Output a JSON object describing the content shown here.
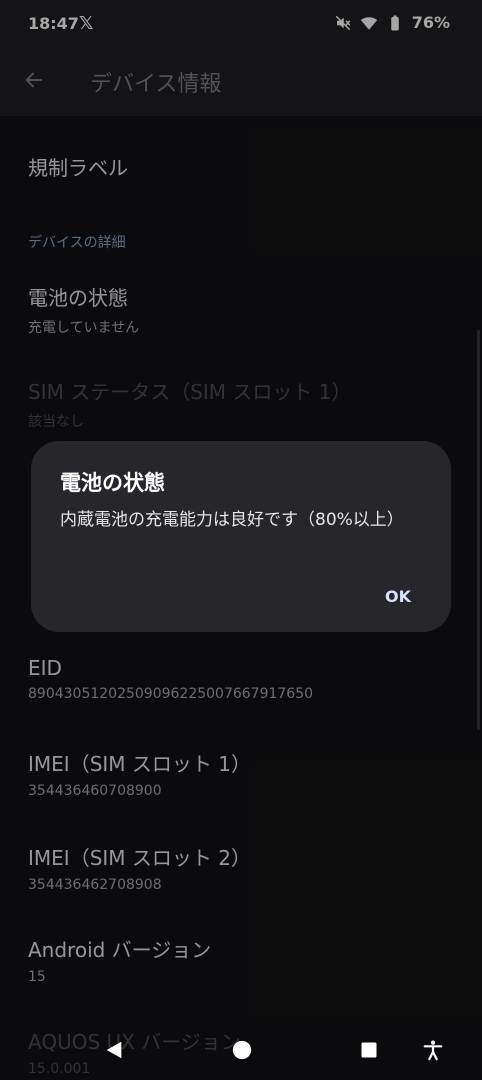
{
  "status_bar": {
    "time": "18:47",
    "battery_percent": "76%"
  },
  "app_bar": {
    "title": "デバイス情報"
  },
  "list": {
    "regulatory_label": "規制ラベル",
    "section_header": "デバイスの詳細",
    "items": [
      {
        "title": "電池の状態",
        "subtitle": "充電していません"
      },
      {
        "title": "SIM ステータス（SIM スロット 1）",
        "subtitle": "該当なし"
      },
      {
        "title": "EID",
        "subtitle": "89043051202509096225007667917650"
      },
      {
        "title": "IMEI（SIM スロット 1）",
        "subtitle": "354436460708900"
      },
      {
        "title": "IMEI（SIM スロット 2）",
        "subtitle": "354436462708908"
      },
      {
        "title": "Android バージョン",
        "subtitle": "15"
      },
      {
        "title": "AQUOS UX バージョン",
        "subtitle": "15.0.001"
      }
    ]
  },
  "dialog": {
    "title": "電池の状態",
    "message": "内蔵電池の充電能力は良好です（80%以上）",
    "ok_label": "OK"
  },
  "colors": {
    "background": "#121214",
    "dialog_background": "#26262b",
    "accent": "#d7e3ff",
    "section_header": "#8fa6c9"
  },
  "icons": {
    "status": [
      "x-logo-icon",
      "mute-icon",
      "wifi-icon",
      "battery-icon"
    ],
    "nav": [
      "back-triangle-icon",
      "home-circle-icon",
      "recents-square-icon",
      "accessibility-icon"
    ]
  }
}
